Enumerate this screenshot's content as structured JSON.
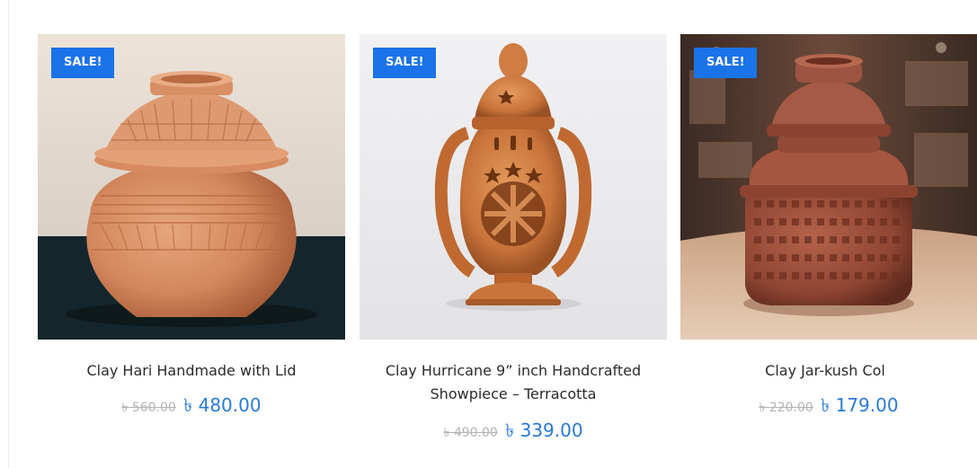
{
  "products": [
    {
      "badge": "SALE!",
      "title": "Clay Hari Handmade with Lid",
      "old_price": "৳ 560.00",
      "new_price": "৳ 480.00",
      "image_icon": "clay-pot-image"
    },
    {
      "badge": "SALE!",
      "title": "Clay Hurricane 9” inch Handcrafted Showpiece – Terracotta",
      "old_price": "৳ 490.00",
      "new_price": "৳ 339.00",
      "image_icon": "clay-lantern-image"
    },
    {
      "badge": "SALE!",
      "title": "Clay Jar-kush Col",
      "old_price": "৳ 220.00",
      "new_price": "৳ 179.00",
      "image_icon": "clay-jar-image"
    }
  ],
  "colors": {
    "badge_bg": "#1a73e8",
    "price_new": "#2a7ad6",
    "price_old": "#b3b3b3",
    "title_text": "#2b2b2b"
  }
}
